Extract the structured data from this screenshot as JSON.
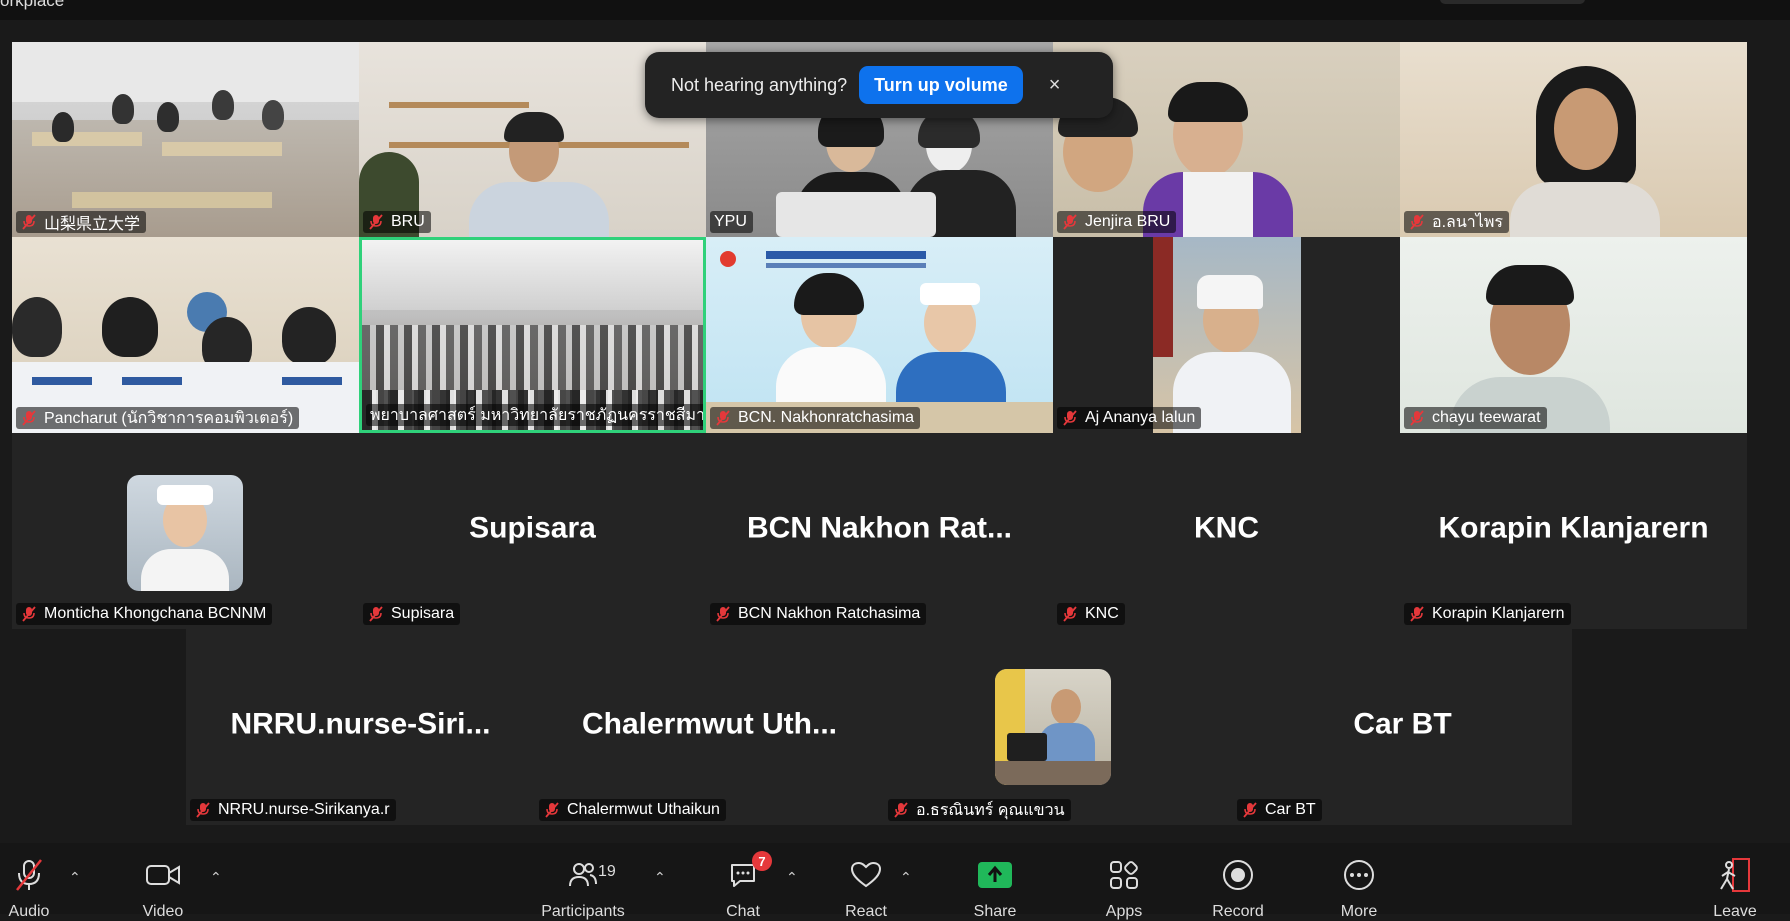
{
  "window": {
    "title_fragment": "orkplace"
  },
  "notification": {
    "message": "Not hearing anything?",
    "button": "Turn up volume",
    "close": "×"
  },
  "participants": [
    {
      "name": "山梨県立大学"
    },
    {
      "name": "BRU"
    },
    {
      "name": "YPU"
    },
    {
      "name": "Jenjira BRU"
    },
    {
      "name": "อ.ลนาไพร"
    },
    {
      "name": "Pancharut (นักวิชาการคอมพิวเตอร์)"
    },
    {
      "name": "พยาบาลศาสตร์ มหาวิทยาลัยราชภัฏนครราชสีมา"
    },
    {
      "name": "BCN. Nakhonratchasima"
    },
    {
      "name": "Aj Ananya lalun"
    },
    {
      "name": "chayu teewarat"
    },
    {
      "name": "Monticha Khongchana BCNNM"
    },
    {
      "name": "Supisara",
      "display": "Supisara"
    },
    {
      "name": "BCN Nakhon Ratchasima",
      "display": "BCN  Nakhon  Rat..."
    },
    {
      "name": "KNC",
      "display": "KNC"
    },
    {
      "name": "Korapin Klanjarern",
      "display": "Korapin Klanjarern"
    },
    {
      "name": "NRRU.nurse-Sirikanya.r",
      "display": "NRRU.nurse-Siri..."
    },
    {
      "name": "Chalermwut Uthaikun",
      "display": "Chalermwut  Uth..."
    },
    {
      "name": "อ.ธรณินทร์ คุณแขวน"
    },
    {
      "name": "Car BT",
      "display": "Car BT"
    }
  ],
  "toolbar": {
    "audio": "Audio",
    "video": "Video",
    "participants": "Participants",
    "participants_count": "19",
    "chat": "Chat",
    "chat_badge": "7",
    "react": "React",
    "share": "Share",
    "apps": "Apps",
    "record": "Record",
    "more": "More",
    "leave": "Leave"
  },
  "colors": {
    "active_speaker": "#2fd17a",
    "primary": "#0e72ed",
    "share": "#20b85a",
    "muted": "#e5383b"
  }
}
